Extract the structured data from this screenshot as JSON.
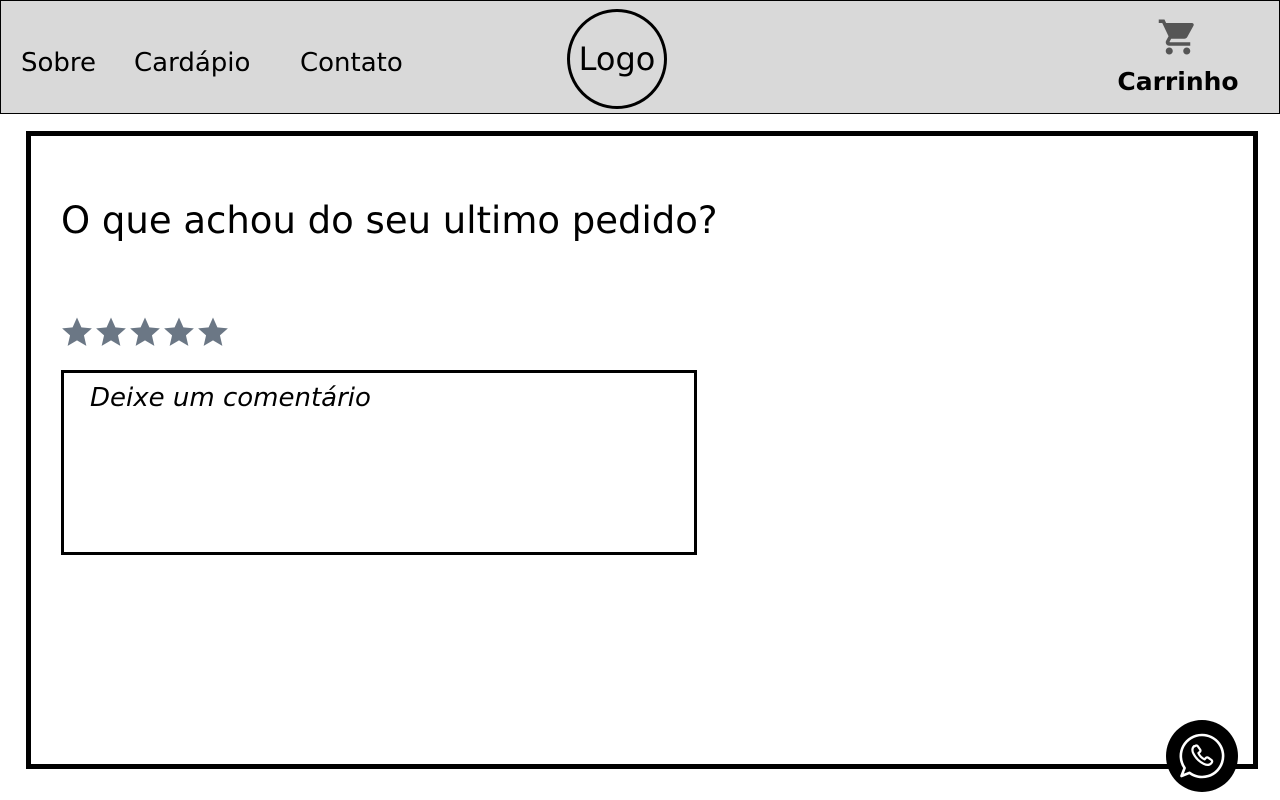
{
  "nav": {
    "items": [
      {
        "label": "Sobre"
      },
      {
        "label": "Cardápio"
      },
      {
        "label": "Contato"
      }
    ],
    "logo_text": "Logo",
    "cart_label": "Carrinho",
    "cart_icon": "cart-icon"
  },
  "review": {
    "question": "O que achou do seu ultimo pedido?",
    "rating_max": 5,
    "rating_value": 0,
    "star_color": "#6b7785",
    "comment_placeholder": "Deixe um comentário",
    "comment_value": ""
  },
  "floating": {
    "icon": "whatsapp-icon"
  },
  "colors": {
    "header_bg": "#d9d9d9",
    "cart_icon": "#555555"
  }
}
